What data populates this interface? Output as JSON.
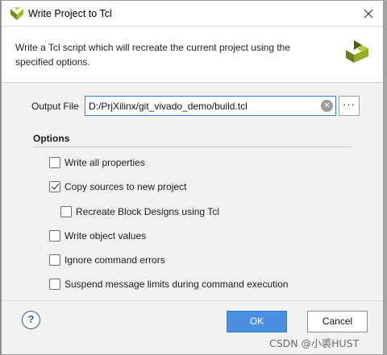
{
  "window": {
    "title": "Write Project to Tcl",
    "close_icon": "close-icon"
  },
  "header": {
    "description": "Write a Tcl script which will recreate the current project using the specified options.",
    "logo": "xilinx-logo-icon"
  },
  "output_file": {
    "label": "Output File",
    "value": "D:/PrjXilinx/git_vivado_demo/build.tcl",
    "clear_icon": "clear-icon",
    "browse_label": "···"
  },
  "options": {
    "title": "Options",
    "items": [
      {
        "label": "Write all properties",
        "checked": false
      },
      {
        "label": "Copy sources to new project",
        "checked": true
      },
      {
        "label": "Recreate Block Designs using Tcl",
        "checked": false
      },
      {
        "label": "Write object values",
        "checked": false
      },
      {
        "label": "Ignore command errors",
        "checked": false
      },
      {
        "label": "Suspend message limits during command execution",
        "checked": false
      }
    ]
  },
  "footer": {
    "help_label": "?",
    "ok_label": "OK",
    "cancel_label": "Cancel"
  },
  "watermark": "CSDN @小裘HUST",
  "colors": {
    "accent": "#4a8fe0",
    "logo_green": "#7a8c24"
  }
}
